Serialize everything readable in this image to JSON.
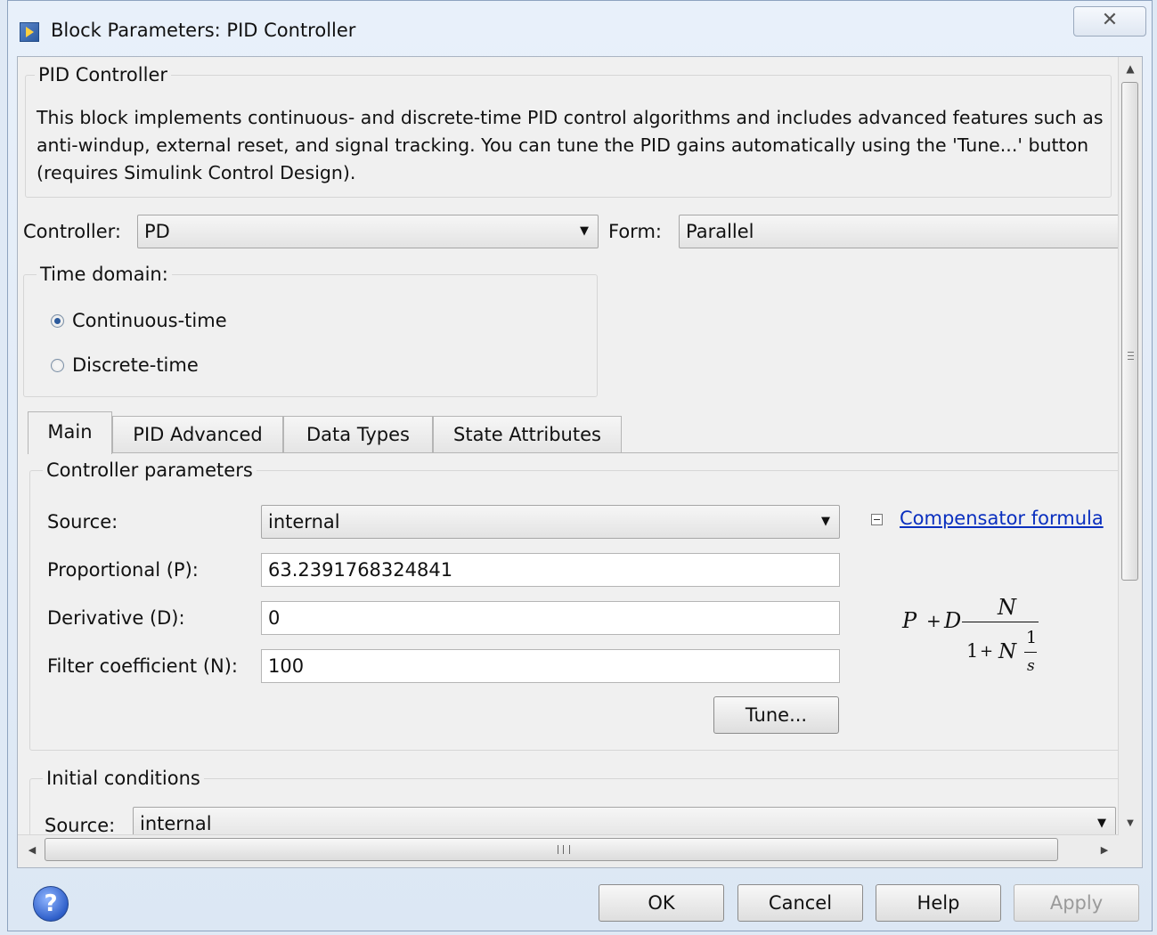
{
  "window": {
    "title": "Block Parameters: PID Controller",
    "close_glyph": "✕"
  },
  "header_group": {
    "title": "PID Controller",
    "description": "This block implements continuous- and discrete-time PID control algorithms and includes advanced features such as anti-windup, external reset, and signal tracking. You can tune the PID gains automatically using the 'Tune...' button (requires Simulink Control Design)."
  },
  "controller": {
    "label": "Controller:",
    "value": "PD"
  },
  "form": {
    "label": "Form:",
    "value": "Parallel"
  },
  "time_domain": {
    "title": "Time domain:",
    "options": [
      {
        "label": "Continuous-time",
        "selected": true
      },
      {
        "label": "Discrete-time",
        "selected": false
      }
    ]
  },
  "tabs": [
    {
      "label": "Main",
      "active": true
    },
    {
      "label": "PID Advanced",
      "active": false
    },
    {
      "label": "Data Types",
      "active": false
    },
    {
      "label": "State Attributes",
      "active": false
    }
  ],
  "controller_parameters": {
    "title": "Controller parameters",
    "source_label": "Source:",
    "source_value": "internal",
    "proportional_label": "Proportional (P):",
    "proportional_value": "63.2391768324841",
    "derivative_label": "Derivative (D):",
    "derivative_value": "0",
    "filter_label": "Filter coefficient (N):",
    "filter_value": "100",
    "tune_label": "Tune...",
    "compensator_link": "Compensator formula"
  },
  "formula": {
    "p": "P",
    "plus": "+",
    "d": "D",
    "numerator": "N",
    "den_one": "1",
    "den_plus": "+",
    "den_n": "N",
    "inner_num": "1",
    "inner_den": "s"
  },
  "initial_conditions": {
    "title": "Initial conditions",
    "source_label": "Source:",
    "source_value": "internal"
  },
  "buttons": {
    "ok": "OK",
    "cancel": "Cancel",
    "help": "Help",
    "apply": "Apply"
  },
  "icons": {
    "help": "?",
    "dropdown": "▼",
    "scroll_up": "▲",
    "scroll_down": "▼",
    "scroll_left": "◀",
    "scroll_right": "▶"
  },
  "colors": {
    "link": "#0a2fbf",
    "title_bg": "#dfe9f5",
    "panel_bg": "#f0f0f0"
  }
}
